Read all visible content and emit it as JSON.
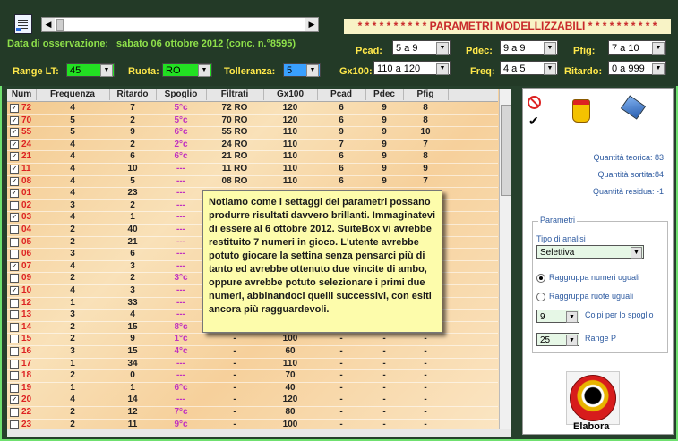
{
  "header": {
    "banner": "* * * * * * * * * * PARAMETRI MODELLIZZABILI * * * * * * * * * *",
    "obs_label": "Data di osservazione:",
    "obs_value": "sabato 06 ottobre 2012 (conc. n.°8595)"
  },
  "controls": {
    "range_label": "Range LT:",
    "range_value": "45",
    "ruota_label": "Ruota:",
    "ruota_value": "RO",
    "tolleranza_label": "Tolleranza:",
    "tolleranza_value": "5",
    "pcad_label": "Pcad:",
    "pcad_value": "5 a 9",
    "pdec_label": "Pdec:",
    "pdec_value": "9 a 9",
    "pfig_label": "Pfig:",
    "pfig_value": "7 a 10",
    "gx100_label": "Gx100:",
    "gx100_value": "110 a 120",
    "freq_label": "Freq:",
    "freq_value": "4 a 5",
    "ritardo_label": "Ritardo:",
    "ritardo_value": "0 a 999"
  },
  "table": {
    "columns": [
      "Num",
      "Frequenza",
      "Ritardo",
      "Spoglio",
      "Filtrati",
      "Gx100",
      "Pcad",
      "Pdec",
      "Pfig"
    ],
    "rows": [
      {
        "checked": true,
        "num": "72",
        "freq": "4",
        "rit": "7",
        "spo": "5°c",
        "fil": "72 RO",
        "gx": "120",
        "pcad": "6",
        "pdec": "9",
        "pfig": "8"
      },
      {
        "checked": true,
        "num": "70",
        "freq": "5",
        "rit": "2",
        "spo": "5°c",
        "fil": "70 RO",
        "gx": "120",
        "pcad": "6",
        "pdec": "9",
        "pfig": "8"
      },
      {
        "checked": true,
        "num": "55",
        "freq": "5",
        "rit": "9",
        "spo": "6°c",
        "fil": "55 RO",
        "gx": "110",
        "pcad": "9",
        "pdec": "9",
        "pfig": "10"
      },
      {
        "checked": true,
        "num": "24",
        "freq": "4",
        "rit": "2",
        "spo": "2°c",
        "fil": "24 RO",
        "gx": "110",
        "pcad": "7",
        "pdec": "9",
        "pfig": "7"
      },
      {
        "checked": true,
        "num": "21",
        "freq": "4",
        "rit": "6",
        "spo": "6°c",
        "fil": "21 RO",
        "gx": "110",
        "pcad": "6",
        "pdec": "9",
        "pfig": "8"
      },
      {
        "checked": true,
        "num": "11",
        "freq": "4",
        "rit": "10",
        "spo": "---",
        "fil": "11 RO",
        "gx": "110",
        "pcad": "6",
        "pdec": "9",
        "pfig": "9"
      },
      {
        "checked": true,
        "num": "08",
        "freq": "4",
        "rit": "5",
        "spo": "---",
        "fil": "08 RO",
        "gx": "110",
        "pcad": "6",
        "pdec": "9",
        "pfig": "7"
      },
      {
        "checked": true,
        "num": "01",
        "freq": "4",
        "rit": "23",
        "spo": "---",
        "fil": "",
        "gx": "",
        "pcad": "",
        "pdec": "",
        "pfig": ""
      },
      {
        "checked": false,
        "num": "02",
        "freq": "3",
        "rit": "2",
        "spo": "---",
        "fil": "",
        "gx": "",
        "pcad": "",
        "pdec": "",
        "pfig": ""
      },
      {
        "checked": true,
        "num": "03",
        "freq": "4",
        "rit": "1",
        "spo": "---",
        "fil": "",
        "gx": "",
        "pcad": "",
        "pdec": "",
        "pfig": ""
      },
      {
        "checked": false,
        "num": "04",
        "freq": "2",
        "rit": "40",
        "spo": "---",
        "fil": "",
        "gx": "",
        "pcad": "",
        "pdec": "",
        "pfig": ""
      },
      {
        "checked": false,
        "num": "05",
        "freq": "2",
        "rit": "21",
        "spo": "---",
        "fil": "",
        "gx": "",
        "pcad": "",
        "pdec": "",
        "pfig": ""
      },
      {
        "checked": false,
        "num": "06",
        "freq": "3",
        "rit": "6",
        "spo": "---",
        "fil": "",
        "gx": "",
        "pcad": "",
        "pdec": "",
        "pfig": ""
      },
      {
        "checked": true,
        "num": "07",
        "freq": "4",
        "rit": "3",
        "spo": "---",
        "fil": "",
        "gx": "",
        "pcad": "",
        "pdec": "",
        "pfig": ""
      },
      {
        "checked": false,
        "num": "09",
        "freq": "2",
        "rit": "2",
        "spo": "3°c",
        "fil": "",
        "gx": "",
        "pcad": "",
        "pdec": "",
        "pfig": ""
      },
      {
        "checked": true,
        "num": "10",
        "freq": "4",
        "rit": "3",
        "spo": "---",
        "fil": "",
        "gx": "",
        "pcad": "",
        "pdec": "",
        "pfig": ""
      },
      {
        "checked": false,
        "num": "12",
        "freq": "1",
        "rit": "33",
        "spo": "---",
        "fil": "",
        "gx": "",
        "pcad": "",
        "pdec": "",
        "pfig": ""
      },
      {
        "checked": false,
        "num": "13",
        "freq": "3",
        "rit": "4",
        "spo": "---",
        "fil": "",
        "gx": "",
        "pcad": "",
        "pdec": "",
        "pfig": ""
      },
      {
        "checked": false,
        "num": "14",
        "freq": "2",
        "rit": "15",
        "spo": "8°c",
        "fil": "",
        "gx": "",
        "pcad": "",
        "pdec": "",
        "pfig": ""
      },
      {
        "checked": false,
        "num": "15",
        "freq": "2",
        "rit": "9",
        "spo": "1°c",
        "fil": "-",
        "gx": "100",
        "pcad": "-",
        "pdec": "-",
        "pfig": "-"
      },
      {
        "checked": false,
        "num": "16",
        "freq": "3",
        "rit": "15",
        "spo": "4°c",
        "fil": "-",
        "gx": "60",
        "pcad": "-",
        "pdec": "-",
        "pfig": "-"
      },
      {
        "checked": false,
        "num": "17",
        "freq": "1",
        "rit": "34",
        "spo": "---",
        "fil": "-",
        "gx": "110",
        "pcad": "-",
        "pdec": "-",
        "pfig": "-"
      },
      {
        "checked": false,
        "num": "18",
        "freq": "2",
        "rit": "0",
        "spo": "---",
        "fil": "-",
        "gx": "70",
        "pcad": "-",
        "pdec": "-",
        "pfig": "-"
      },
      {
        "checked": false,
        "num": "19",
        "freq": "1",
        "rit": "1",
        "spo": "6°c",
        "fil": "-",
        "gx": "40",
        "pcad": "-",
        "pdec": "-",
        "pfig": "-"
      },
      {
        "checked": true,
        "num": "20",
        "freq": "4",
        "rit": "14",
        "spo": "---",
        "fil": "-",
        "gx": "120",
        "pcad": "-",
        "pdec": "-",
        "pfig": "-"
      },
      {
        "checked": false,
        "num": "22",
        "freq": "2",
        "rit": "12",
        "spo": "7°c",
        "fil": "-",
        "gx": "80",
        "pcad": "-",
        "pdec": "-",
        "pfig": "-"
      },
      {
        "checked": false,
        "num": "23",
        "freq": "2",
        "rit": "11",
        "spo": "9°c",
        "fil": "-",
        "gx": "100",
        "pcad": "-",
        "pdec": "-",
        "pfig": "-"
      }
    ]
  },
  "note": {
    "text": "Notiamo come i settaggi dei parametri possano produrre risultati davvero brillanti. Immaginatevi di essere al 6 ottobre 2012. SuiteBox vi avrebbe restituito 7 numeri in gioco. L'utente avrebbe potuto giocare la settina senza pensarci più di tanto ed avrebbe ottenuto due vincite di ambo, oppure avrebbe potuto selezionare i primi due numeri, abbinandoci quelli successivi, con esiti ancora più ragguardevoli."
  },
  "panel": {
    "qt_teorica": "Quantità teorica: 83",
    "qt_sortita": "Quantità sortita:84",
    "qt_residua": "Quantità residua: -1",
    "group_label": "Parametri",
    "tipo_label": "Tipo di analisi",
    "tipo_value": "Selettiva",
    "radio1": "Raggruppa numeri uguali",
    "radio2": "Raggruppa ruote uguali",
    "colpi_value": "9",
    "colpi_label": "Colpi per lo spoglio",
    "range_value": "25",
    "range_label": "Range P",
    "elabora_label": "Elabora",
    "icons": [
      "no-icon",
      "check-icon",
      "bucket-icon",
      "eraser-icon",
      "power-button-icon"
    ]
  }
}
